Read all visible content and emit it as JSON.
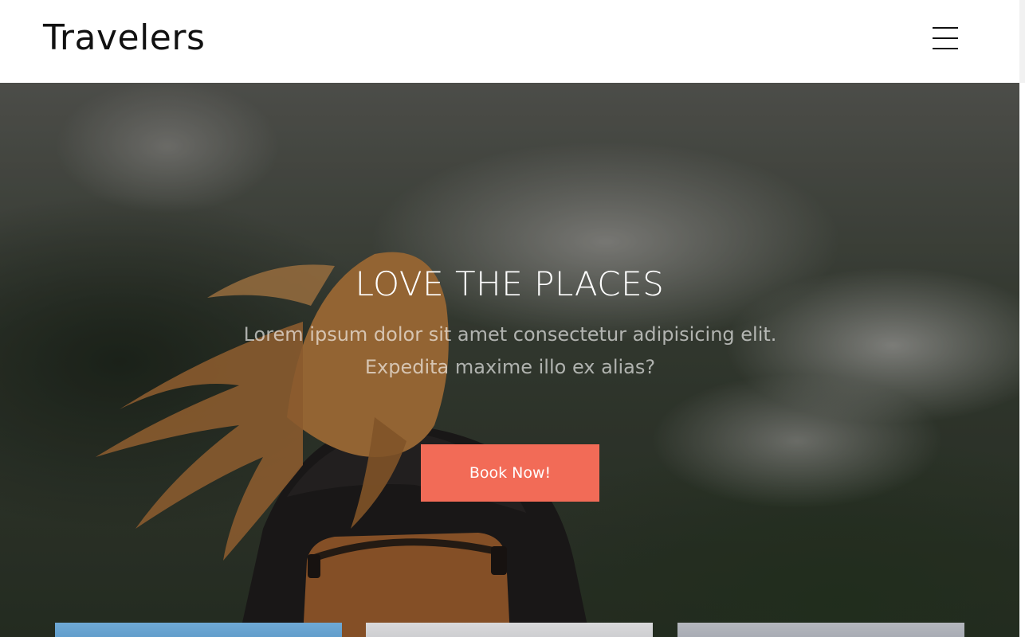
{
  "header": {
    "brand": "Travelers",
    "menu_icon": "hamburger-menu-icon"
  },
  "hero": {
    "title": "LOVE THE PLACES",
    "subtitle_line1": "Lorem ipsum dolor sit amet consectetur adipisicing elit.",
    "subtitle_line2": "Expedita maxime illo ex alias?",
    "cta_label": "Book Now!",
    "cta_color": "#f26b57"
  }
}
